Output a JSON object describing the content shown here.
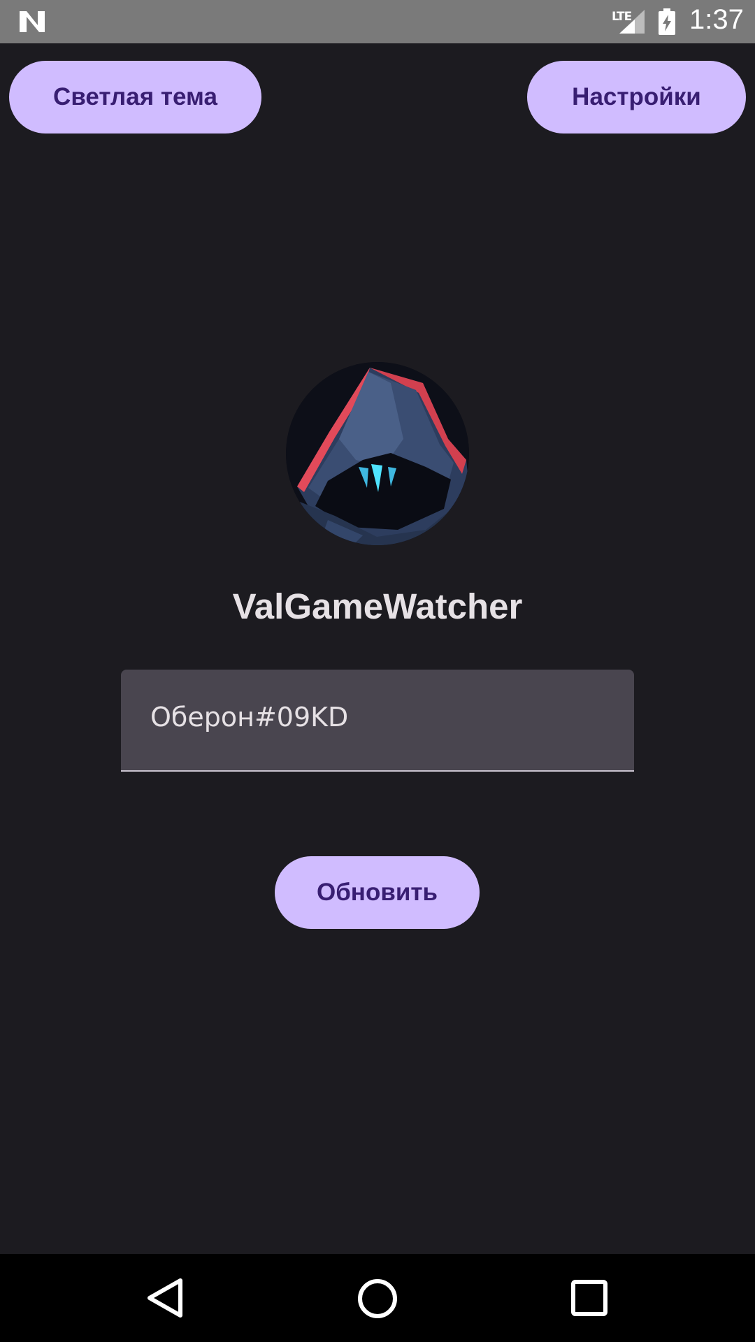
{
  "status_bar": {
    "network_label": "LTE",
    "time": "1:37",
    "icons": [
      "notification-n-icon",
      "lte-signal-icon",
      "battery-charging-icon"
    ]
  },
  "top_bar": {
    "theme_button_label": "Светлая тема",
    "settings_button_label": "Настройки"
  },
  "profile": {
    "avatar_icon": "hooded-agent-avatar",
    "username": "ValGameWatcher"
  },
  "riot_id_field": {
    "value": "Оберон#09KD"
  },
  "actions": {
    "refresh_button_label": "Обновить"
  },
  "nav_bar": {
    "icons": [
      "back-icon",
      "home-icon",
      "recents-icon"
    ]
  },
  "colors": {
    "background": "#1c1b20",
    "button_fill": "#d0bcff",
    "button_text": "#381e72",
    "field_fill": "#49454f",
    "text_primary": "#e6e1e5"
  }
}
